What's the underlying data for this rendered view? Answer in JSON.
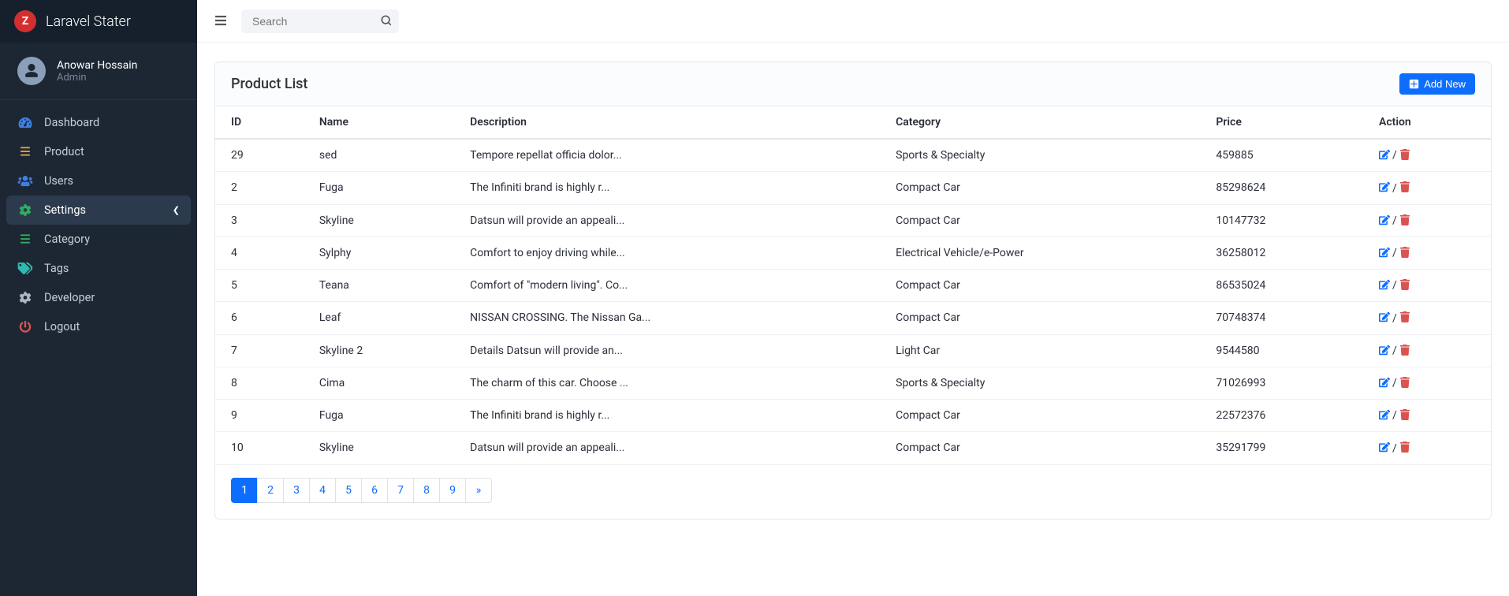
{
  "brand": {
    "initial": "Z",
    "title": "Laravel Stater"
  },
  "user": {
    "name": "Anowar Hossain",
    "role": "Admin"
  },
  "sidebar": {
    "items": [
      {
        "label": "Dashboard",
        "icon": "tachometer",
        "color": "icon-blue"
      },
      {
        "label": "Product",
        "icon": "list",
        "color": "icon-orange"
      },
      {
        "label": "Users",
        "icon": "users",
        "color": "icon-blue"
      },
      {
        "label": "Settings",
        "icon": "gear",
        "color": "icon-green",
        "expandable": true,
        "active": true
      },
      {
        "label": "Category",
        "icon": "list",
        "color": "icon-green"
      },
      {
        "label": "Tags",
        "icon": "tags",
        "color": "icon-teal"
      },
      {
        "label": "Developer",
        "icon": "gear",
        "color": "icon-gray"
      },
      {
        "label": "Logout",
        "icon": "power",
        "color": "icon-red"
      }
    ]
  },
  "search": {
    "placeholder": "Search"
  },
  "page": {
    "title": "Product List",
    "add_label": "Add New"
  },
  "columns": [
    "ID",
    "Name",
    "Description",
    "Category",
    "Price",
    "Action"
  ],
  "rows": [
    {
      "id": "29",
      "name": "sed",
      "desc": "Tempore repellat officia dolor...",
      "cat": "Sports & Specialty",
      "price": "459885"
    },
    {
      "id": "2",
      "name": "Fuga",
      "desc": "The Infiniti brand is highly r...",
      "cat": "Compact Car",
      "price": "85298624"
    },
    {
      "id": "3",
      "name": "Skyline",
      "desc": "Datsun will provide an appeali...",
      "cat": "Compact Car",
      "price": "10147732"
    },
    {
      "id": "4",
      "name": "Sylphy",
      "desc": "Comfort to enjoy driving while...",
      "cat": "Electrical Vehicle/e-Power",
      "price": "36258012"
    },
    {
      "id": "5",
      "name": "Teana",
      "desc": "Comfort of \"modern living\". Co...",
      "cat": "Compact Car",
      "price": "86535024"
    },
    {
      "id": "6",
      "name": "Leaf",
      "desc": "NISSAN CROSSING. The Nissan Ga...",
      "cat": "Compact Car",
      "price": "70748374"
    },
    {
      "id": "7",
      "name": "Skyline 2",
      "desc": "Details Datsun will provide an...",
      "cat": "Light Car",
      "price": "9544580"
    },
    {
      "id": "8",
      "name": "Cima",
      "desc": "The charm of this car. Choose ...",
      "cat": "Sports & Specialty",
      "price": "71026993"
    },
    {
      "id": "9",
      "name": "Fuga",
      "desc": "The Infiniti brand is highly r...",
      "cat": "Compact Car",
      "price": "22572376"
    },
    {
      "id": "10",
      "name": "Skyline",
      "desc": "Datsun will provide an appeali...",
      "cat": "Compact Car",
      "price": "35291799"
    }
  ],
  "pagination": {
    "pages": [
      "1",
      "2",
      "3",
      "4",
      "5",
      "6",
      "7",
      "8",
      "9"
    ],
    "next": "»",
    "active": "1"
  }
}
